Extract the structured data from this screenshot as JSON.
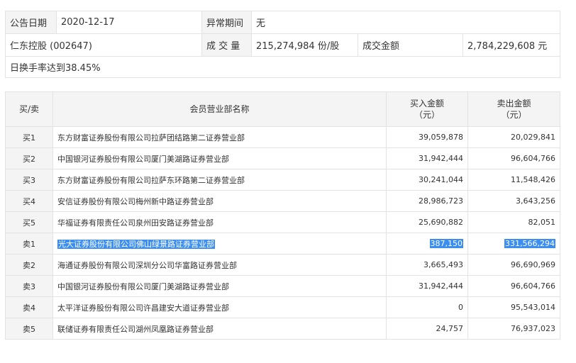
{
  "info": {
    "date_label": "公告日期",
    "date_value": "2020-12-17",
    "period_label": "异常期间",
    "period_value": "无",
    "stock": "仁东控股 (002647)",
    "volume_label": "成 交 量",
    "volume_value": "215,274,984 份/股",
    "amount_label": "成交金额",
    "amount_value": "2,784,229,608 元",
    "reason": "日换手率达到38.45%"
  },
  "table": {
    "headers": {
      "side": "买/卖",
      "dept": "会员营业部名称",
      "buy_line1": "买入金额",
      "buy_line2": "（元）",
      "sell_line1": "卖出金额",
      "sell_line2": "（元）"
    },
    "rows": [
      {
        "side": "买1",
        "dept": "东方财富证券股份有限公司拉萨团结路第二证券营业部",
        "buy": "39,059,878",
        "sell": "20,029,841"
      },
      {
        "side": "买2",
        "dept": "中国银河证券股份有限公司厦门美湖路证券营业部",
        "buy": "31,942,444",
        "sell": "96,604,766"
      },
      {
        "side": "买3",
        "dept": "东方财富证券股份有限公司拉萨东环路第二证券营业部",
        "buy": "30,241,044",
        "sell": "11,548,426"
      },
      {
        "side": "买4",
        "dept": "安信证券股份有限公司梅州新中路证券营业部",
        "buy": "28,986,723",
        "sell": "3,643,256"
      },
      {
        "side": "买5",
        "dept": "华福证券有限责任公司泉州田安路证券营业部",
        "buy": "25,690,882",
        "sell": "82,051"
      },
      {
        "side": "卖1",
        "dept": "光大证券股份有限公司佛山绿景路证券营业部",
        "buy": "387,150",
        "sell": "331,566,294"
      },
      {
        "side": "卖2",
        "dept": "海通证券股份有限公司深圳分公司华富路证券营业部",
        "buy": "3,665,493",
        "sell": "96,690,969"
      },
      {
        "side": "卖3",
        "dept": "中国银河证券股份有限公司厦门美湖路证券营业部",
        "buy": "31,942,444",
        "sell": "96,604,766"
      },
      {
        "side": "卖4",
        "dept": "太平洋证券股份有限公司许昌建安大道证券营业部",
        "buy": "0",
        "sell": "95,543,014"
      },
      {
        "side": "卖5",
        "dept": "联储证券有限责任公司湖州凤凰路证券营业部",
        "buy": "24,757",
        "sell": "76,937,023"
      }
    ]
  },
  "selection_highlight_color": "#3b8df0"
}
